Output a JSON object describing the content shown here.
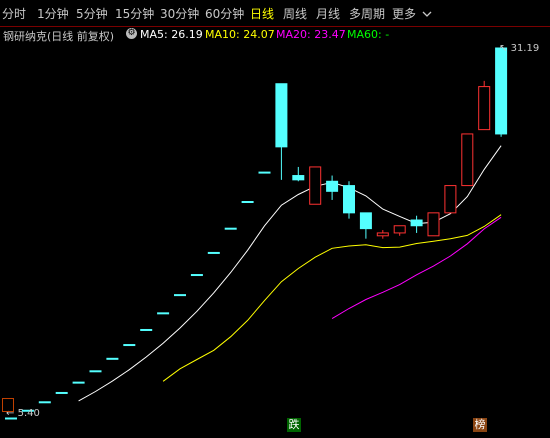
{
  "tabs": [
    {
      "label": "分时"
    },
    {
      "label": "1分钟"
    },
    {
      "label": "5分钟"
    },
    {
      "label": "15分钟"
    },
    {
      "label": "30分钟"
    },
    {
      "label": "60分钟"
    },
    {
      "label": "日线",
      "active": true
    },
    {
      "label": "周线"
    },
    {
      "label": "月线"
    },
    {
      "label": "多周期"
    },
    {
      "label": "更多"
    }
  ],
  "more_icon": "chevron-down-icon",
  "info": {
    "title": "钢研纳克(日线 前复权)",
    "ma5": "MA5: 26.19",
    "ma10": "MA10: 24.07",
    "ma20": "MA20: 23.47",
    "ma60": "MA60: -"
  },
  "labels": {
    "high": "31.19",
    "low": "5.40",
    "marker_down": "跌",
    "marker_up": "榜"
  },
  "colors": {
    "up": "#ff3232",
    "down": "#54ffff",
    "ma5": "#ffffff",
    "ma10": "#ffff00",
    "ma20": "#ff00ff",
    "ma60": "#00ff00"
  },
  "candles": [
    {
      "o": 5.4,
      "h": 5.4,
      "l": 5.4,
      "c": 5.4
    },
    {
      "o": 5.94,
      "h": 5.94,
      "l": 5.94,
      "c": 5.94
    },
    {
      "o": 6.53,
      "h": 6.53,
      "l": 6.53,
      "c": 6.53
    },
    {
      "o": 7.18,
      "h": 7.18,
      "l": 7.18,
      "c": 7.18
    },
    {
      "o": 7.9,
      "h": 7.9,
      "l": 7.9,
      "c": 7.9
    },
    {
      "o": 8.69,
      "h": 8.69,
      "l": 8.69,
      "c": 8.69
    },
    {
      "o": 9.56,
      "h": 9.56,
      "l": 9.56,
      "c": 9.56
    },
    {
      "o": 10.52,
      "h": 10.52,
      "l": 10.52,
      "c": 10.52
    },
    {
      "o": 11.57,
      "h": 11.57,
      "l": 11.57,
      "c": 11.57
    },
    {
      "o": 12.73,
      "h": 12.73,
      "l": 12.73,
      "c": 12.73
    },
    {
      "o": 14.0,
      "h": 14.0,
      "l": 14.0,
      "c": 14.0
    },
    {
      "o": 15.4,
      "h": 15.4,
      "l": 15.4,
      "c": 15.4
    },
    {
      "o": 16.94,
      "h": 16.94,
      "l": 16.94,
      "c": 16.94
    },
    {
      "o": 18.63,
      "h": 18.63,
      "l": 18.63,
      "c": 18.63
    },
    {
      "o": 20.49,
      "h": 20.49,
      "l": 20.49,
      "c": 20.49
    },
    {
      "o": 22.54,
      "h": 22.54,
      "l": 22.54,
      "c": 22.54
    },
    {
      "o": 28.7,
      "h": 28.7,
      "l": 22.0,
      "c": 24.3
    },
    {
      "o": 22.3,
      "h": 22.9,
      "l": 21.9,
      "c": 22.0
    },
    {
      "o": 20.3,
      "h": 22.9,
      "l": 20.3,
      "c": 22.9
    },
    {
      "o": 21.9,
      "h": 22.3,
      "l": 20.6,
      "c": 21.2
    },
    {
      "o": 21.6,
      "h": 21.9,
      "l": 19.3,
      "c": 19.7
    },
    {
      "o": 19.7,
      "h": 19.7,
      "l": 17.9,
      "c": 18.6
    },
    {
      "o": 18.1,
      "h": 18.5,
      "l": 17.9,
      "c": 18.3
    },
    {
      "o": 18.3,
      "h": 18.8,
      "l": 18.1,
      "c": 18.8
    },
    {
      "o": 19.2,
      "h": 19.5,
      "l": 18.3,
      "c": 18.8
    },
    {
      "o": 18.1,
      "h": 19.7,
      "l": 18.1,
      "c": 19.7
    },
    {
      "o": 19.7,
      "h": 21.6,
      "l": 19.7,
      "c": 21.6
    },
    {
      "o": 21.6,
      "h": 25.2,
      "l": 21.6,
      "c": 25.2
    },
    {
      "o": 25.5,
      "h": 28.9,
      "l": 25.5,
      "c": 28.5
    },
    {
      "o": 31.19,
      "h": 31.19,
      "l": 25.0,
      "c": 25.2
    }
  ],
  "ma5_values": [
    null,
    null,
    null,
    null,
    6.59,
    7.25,
    7.97,
    8.77,
    9.65,
    10.61,
    11.67,
    12.84,
    14.13,
    15.54,
    17.09,
    18.8,
    20.23,
    20.98,
    21.55,
    21.82,
    21.45,
    20.88,
    19.96,
    19.45,
    18.95,
    19.04,
    19.64,
    20.83,
    22.73,
    24.38
  ],
  "ma10_values": [
    null,
    null,
    null,
    null,
    null,
    null,
    null,
    null,
    null,
    7.96,
    8.83,
    9.48,
    10.12,
    11.07,
    12.2,
    13.58,
    14.9,
    15.82,
    16.61,
    17.23,
    17.39,
    17.47,
    17.28,
    17.31,
    17.56,
    17.72,
    17.9,
    18.13,
    18.75,
    19.57
  ],
  "ma20_values": [
    null,
    null,
    null,
    null,
    null,
    null,
    null,
    null,
    null,
    null,
    null,
    null,
    null,
    null,
    null,
    null,
    null,
    null,
    null,
    12.33,
    13.03,
    13.66,
    14.16,
    14.7,
    15.38,
    15.99,
    16.69,
    17.54,
    18.58,
    19.39
  ]
}
